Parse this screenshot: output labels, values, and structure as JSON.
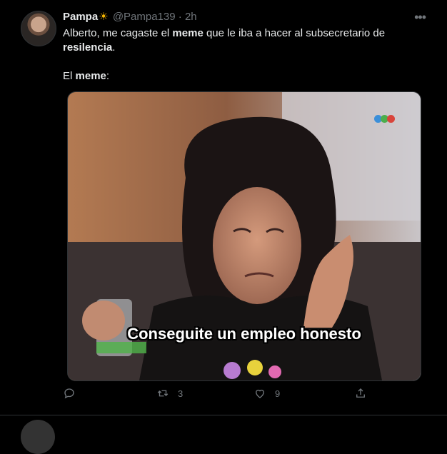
{
  "tweet": {
    "display_name": "Pampa",
    "name_emoji": "☀",
    "handle": "@Pampa139",
    "separator": "·",
    "time": "2h",
    "more_label": "•••",
    "text_line1_a": "Alberto, me cagaste el ",
    "text_line1_b": "meme",
    "text_line1_c": " que le iba a hacer al subsecretario de ",
    "text_line1_d": "resilencia",
    "text_line1_e": ".",
    "text_line2_a": "El ",
    "text_line2_b": "meme",
    "text_line2_c": ":",
    "media": {
      "caption": "Conseguite un empleo honesto",
      "logo_colors": [
        "#3b8fd9",
        "#4cae4c",
        "#d9443b"
      ]
    },
    "actions": {
      "reply_count": "",
      "retweet_count": "3",
      "like_count": "9",
      "share_count": ""
    }
  }
}
